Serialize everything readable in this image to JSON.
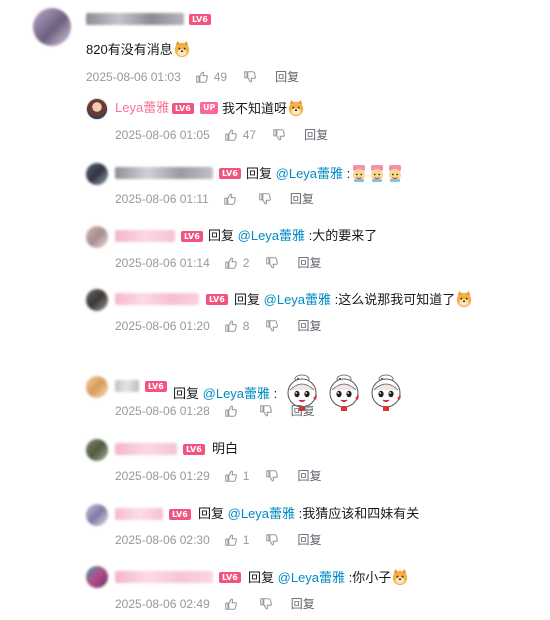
{
  "comments": [
    {
      "level": "LV6",
      "text": "820有没有消息",
      "time": "2025-08-06 01:03",
      "likes": "49",
      "reply_label": "回复"
    },
    {
      "username": "Leya蕾雅",
      "level": "LV6",
      "badge": "UP",
      "text": "我不知道呀",
      "time": "2025-08-06 01:05",
      "likes": "47",
      "reply_label": "回复"
    },
    {
      "level": "LV6",
      "reply_prefix": "回复",
      "mention": "@Leya蕾雅",
      "text": ":",
      "time": "2025-08-06 01:11",
      "likes": "",
      "reply_label": "回复"
    },
    {
      "level": "LV6",
      "reply_prefix": "回复",
      "mention": "@Leya蕾雅",
      "text": ":大的要来了",
      "time": "2025-08-06 01:14",
      "likes": "2",
      "reply_label": "回复"
    },
    {
      "level": "LV6",
      "reply_prefix": "回复",
      "mention": "@Leya蕾雅",
      "text": ":这么说那我可知道了",
      "time": "2025-08-06 01:20",
      "likes": "8",
      "reply_label": "回复"
    },
    {
      "level": "LV6",
      "reply_prefix": "回复",
      "mention": "@Leya蕾雅",
      "text": ":",
      "time": "2025-08-06 01:28",
      "likes": "",
      "reply_label": "回复"
    },
    {
      "level": "LV6",
      "text": "明白",
      "time": "2025-08-06 01:29",
      "likes": "1",
      "reply_label": "回复"
    },
    {
      "level": "LV6",
      "reply_prefix": "回复",
      "mention": "@Leya蕾雅",
      "text": ":我猜应该和四妹有关",
      "time": "2025-08-06 02:30",
      "likes": "1",
      "reply_label": "回复"
    },
    {
      "level": "LV6",
      "reply_prefix": "回复",
      "mention": "@Leya蕾雅",
      "text": ":你小子",
      "time": "2025-08-06 02:49",
      "likes": "",
      "reply_label": "回复"
    }
  ],
  "colors": {
    "username_pink": "#fb7299",
    "mention_blue": "#008ac5",
    "meta_gray": "#9499a0",
    "level_badge": "#f3537f"
  },
  "icons": [
    "like-icon",
    "dislike-icon",
    "doge-emoji-icon",
    "sticker-emoji-icon"
  ]
}
